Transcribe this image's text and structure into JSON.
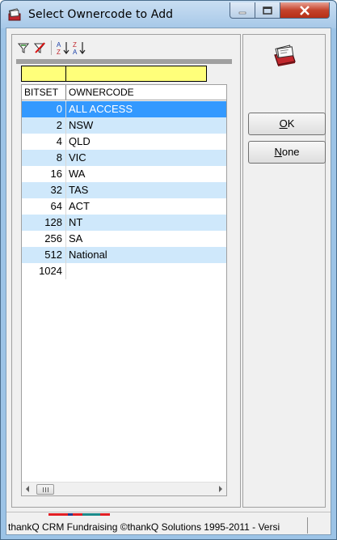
{
  "window": {
    "title": "Select Ownercode to Add",
    "icon": "cardfile-icon"
  },
  "toolbar": {
    "tools": [
      "filter-icon",
      "clear-filter-icon",
      "sort-ascending-icon",
      "sort-descending-icon"
    ]
  },
  "grid": {
    "columns": [
      "BITSET",
      "OWNERCODE"
    ],
    "rows": [
      {
        "bitset": "0",
        "ownercode": "ALL ACCESS"
      },
      {
        "bitset": "2",
        "ownercode": "NSW"
      },
      {
        "bitset": "4",
        "ownercode": "QLD"
      },
      {
        "bitset": "8",
        "ownercode": "VIC"
      },
      {
        "bitset": "16",
        "ownercode": "WA"
      },
      {
        "bitset": "32",
        "ownercode": "TAS"
      },
      {
        "bitset": "64",
        "ownercode": "ACT"
      },
      {
        "bitset": "128",
        "ownercode": "NT"
      },
      {
        "bitset": "256",
        "ownercode": "SA"
      },
      {
        "bitset": "512",
        "ownercode": "National"
      },
      {
        "bitset": "1024",
        "ownercode": ""
      }
    ],
    "selected_row": 0
  },
  "buttons": {
    "ok": {
      "accel": "O",
      "rest": "K"
    },
    "none": {
      "accel": "N",
      "rest": "one"
    }
  },
  "status": {
    "text": "thankQ CRM Fundraising ©thankQ Solutions 1995-2011 - Versi",
    "stripe_colors": [
      "#e31e24",
      "#1f3c8f",
      "#e31e24",
      "#1c8a8a",
      "#e31e24"
    ]
  },
  "colors": {
    "filter_row": "#ffff7a",
    "selected_row": "#3399ff",
    "alt_row": "#cfe8fb"
  }
}
